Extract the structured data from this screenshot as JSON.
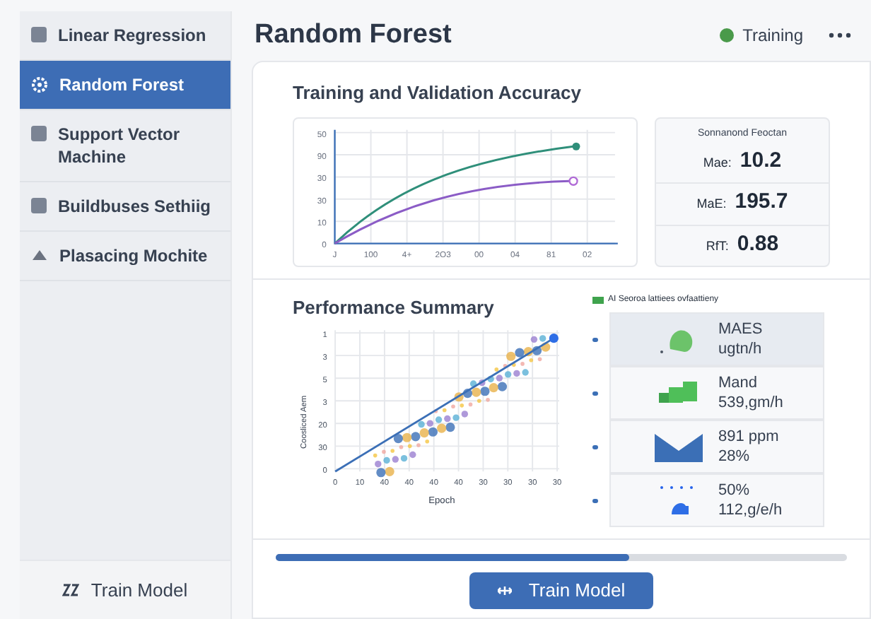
{
  "sidebar": {
    "items": [
      {
        "label": "Linear Regression",
        "kind": "square",
        "selected": false
      },
      {
        "label": "Random Forest",
        "kind": "gear",
        "selected": true
      },
      {
        "label": "Support Vector Machine",
        "kind": "square",
        "selected": false
      },
      {
        "label": "Buildbuses Sethiig",
        "kind": "square",
        "selected": false
      },
      {
        "label": "Plasacing Mochite",
        "kind": "triangle",
        "selected": false
      }
    ],
    "footer_button": "Train Model"
  },
  "header": {
    "title": "Random Forest",
    "status": "Training"
  },
  "accuracy_card": {
    "title": "Training and Validation Accuracy",
    "y_ticks": [
      "50",
      "90",
      "30",
      "30",
      "10",
      "0"
    ],
    "x_ticks": [
      "J",
      "100",
      "4+",
      "2O3",
      "00",
      "04",
      "81",
      "02"
    ],
    "metrics_title": "Sonnanond Feoctan",
    "metrics": [
      {
        "label": "Mae:",
        "value": "10.2"
      },
      {
        "label": "MaE:",
        "value": "195.7"
      },
      {
        "label": "RfT:",
        "value": "0.88"
      }
    ]
  },
  "performance_card": {
    "title": "Performance Summary",
    "ylabel": "Coosliced Aem",
    "xlabel": "Epoch",
    "y_ticks": [
      "1",
      "3",
      "5",
      "3",
      "20",
      "30",
      "0"
    ],
    "x_ticks": [
      "0",
      "10",
      "40",
      "40",
      "40",
      "40",
      "30",
      "30",
      "30",
      "30"
    ],
    "legend": "AI Seoroa lattiees ovfaattieny",
    "items": [
      {
        "kind": "blob",
        "line1": "MAES",
        "line2": "ugtn/h",
        "selected": true
      },
      {
        "kind": "blocks",
        "line1": "Mand",
        "line2": "539,gm/h",
        "selected": false
      },
      {
        "kind": "mountain",
        "line1": "891 ppm",
        "line2": "28%",
        "selected": false
      },
      {
        "kind": "dots",
        "line1": "50%",
        "line2": "112,g/e/h",
        "selected": false
      }
    ]
  },
  "progress": {
    "level": 0.62
  },
  "train_button": "Train Model"
}
